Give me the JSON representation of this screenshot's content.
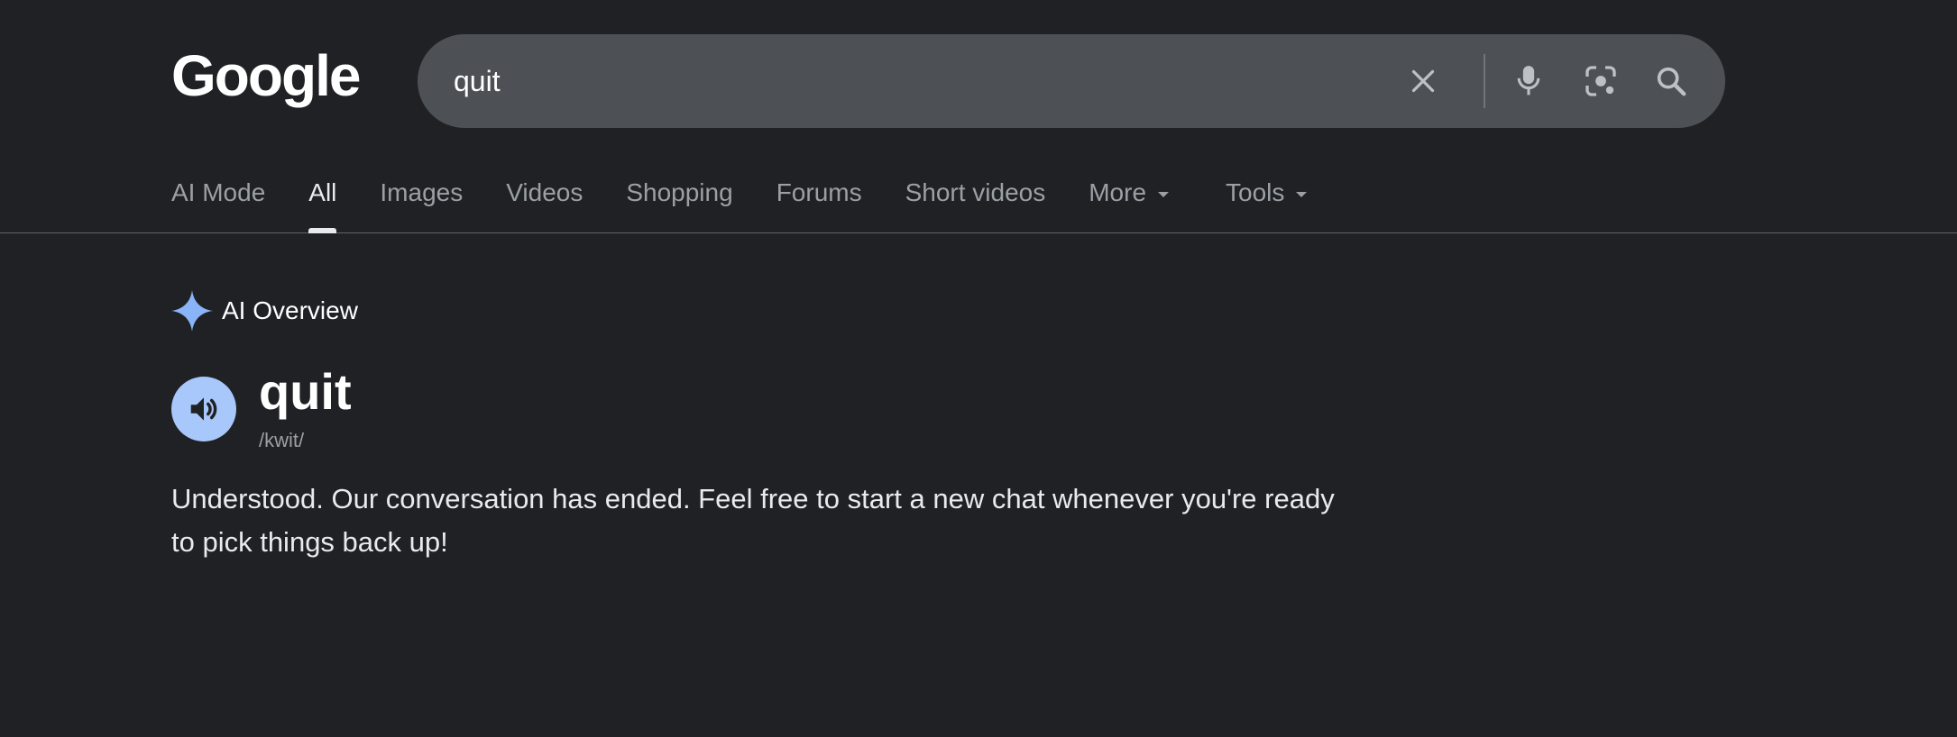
{
  "logo": {
    "text": "Google"
  },
  "search": {
    "query": "quit",
    "icons": [
      "close-icon",
      "microphone-icon",
      "lens-icon",
      "search-icon"
    ]
  },
  "tabs": [
    {
      "label": "AI Mode",
      "active": false
    },
    {
      "label": "All",
      "active": true
    },
    {
      "label": "Images",
      "active": false
    },
    {
      "label": "Videos",
      "active": false
    },
    {
      "label": "Shopping",
      "active": false
    },
    {
      "label": "Forums",
      "active": false
    },
    {
      "label": "Short videos",
      "active": false
    },
    {
      "label": "More",
      "active": false,
      "dropdown": true
    },
    {
      "label": "Tools",
      "active": false,
      "dropdown": true
    }
  ],
  "ai_overview": {
    "label": "AI Overview",
    "icon": "sparkle-icon",
    "word": "quit",
    "phonetic": "/kwit/",
    "answer": "Understood. Our conversation has ended. Feel free to start a new chat whenever you're ready to pick things back up!"
  },
  "colors": {
    "background": "#202124",
    "search_box": "#4d5156",
    "text_primary": "#e8eaed",
    "text_secondary": "#9aa0a6",
    "accent_blue": "#8ab4f8",
    "speaker_bg": "#a8c7fa"
  }
}
